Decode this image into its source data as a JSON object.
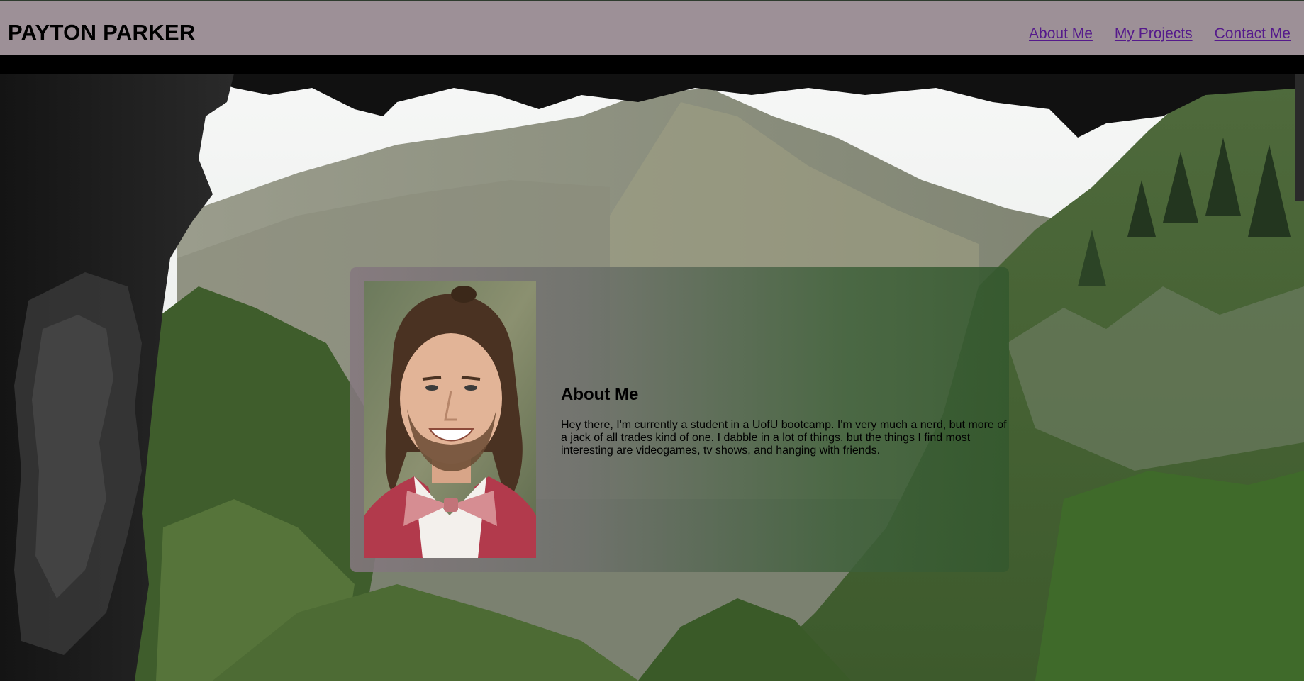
{
  "header": {
    "title": "PAYTON PARKER",
    "nav": [
      {
        "label": "About Me"
      },
      {
        "label": "My Projects"
      },
      {
        "label": "Contact Me"
      }
    ]
  },
  "about": {
    "heading": "About Me",
    "body": "Hey there, I'm currently a student in a UofU bootcamp. I'm very much a nerd, but more of a jack of all trades kind of one. I dabble in a lot of things, but the things I find most interesting are videogames, tv shows, and hanging with friends."
  },
  "colors": {
    "header_bg": "#9d9097",
    "link": "#551a8b",
    "card_left": "#85787f",
    "card_right": "#34582e"
  },
  "images": {
    "background": "mountain-canyon-through-cave-photo",
    "portrait": "smiling-man-pink-bowtie-photo"
  }
}
